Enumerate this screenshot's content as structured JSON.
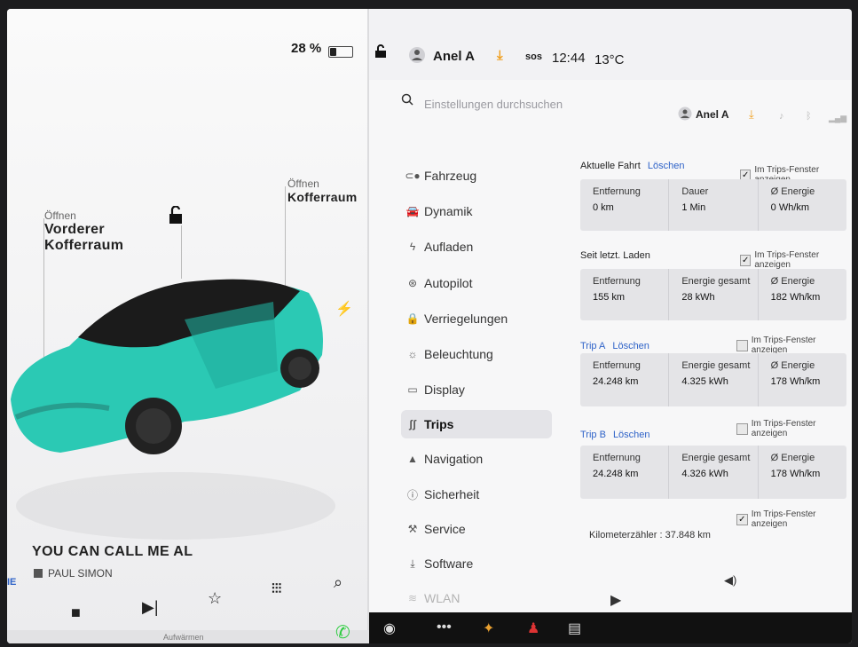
{
  "status": {
    "battery": "28 %",
    "battery_level": 0.28,
    "user": "Anel A",
    "sos": "sos",
    "time": "12:44",
    "temp": "13°C"
  },
  "car": {
    "frunk_open": "Öffnen",
    "frunk_title_1": "Vorderer",
    "frunk_title_2": "Kofferraum",
    "trunk_open": "Öffnen",
    "trunk_title": "Kofferraum",
    "body_color": "#2bc9b4"
  },
  "media": {
    "song": "YOU CAN CALL ME AL",
    "artist": "PAUL SIMON",
    "footer": "Aufwärmen"
  },
  "search": {
    "placeholder": "Einstellungen durchsuchen"
  },
  "header_right": {
    "user": "Anel A"
  },
  "nav": [
    {
      "label": "Fahrzeug",
      "icon": "toggle-icon"
    },
    {
      "label": "Dynamik",
      "icon": "car-icon"
    },
    {
      "label": "Aufladen",
      "icon": "bolt-icon"
    },
    {
      "label": "Autopilot",
      "icon": "steering-wheel-icon"
    },
    {
      "label": "Verriegelungen",
      "icon": "lock-icon"
    },
    {
      "label": "Beleuchtung",
      "icon": "sun-icon"
    },
    {
      "label": "Display",
      "icon": "display-icon"
    },
    {
      "label": "Trips",
      "icon": "trips-icon"
    },
    {
      "label": "Navigation",
      "icon": "navigation-icon"
    },
    {
      "label": "Sicherheit",
      "icon": "safety-icon"
    },
    {
      "label": "Service",
      "icon": "wrench-icon"
    },
    {
      "label": "Software",
      "icon": "download-icon"
    },
    {
      "label": "WLAN",
      "icon": "wifi-icon"
    }
  ],
  "trips": {
    "current": {
      "title": "Aktuelle Fahrt",
      "link": "Löschen",
      "show": "Im Trips-Fenster anzeigen",
      "checked": true,
      "labels": [
        "Entfernung",
        "Dauer",
        "Ø Energie"
      ],
      "values": [
        "0 km",
        "1 Min",
        "0 Wh/km"
      ]
    },
    "since_charge": {
      "title": "Seit letzt. Laden",
      "show": "Im Trips-Fenster anzeigen",
      "checked": true,
      "labels": [
        "Entfernung",
        "Energie gesamt",
        "Ø Energie"
      ],
      "values": [
        "155 km",
        "28 kWh",
        "182 Wh/km"
      ]
    },
    "trip_a": {
      "title": "Trip A",
      "link": "Löschen",
      "show": "Im Trips-Fenster anzeigen",
      "checked": false,
      "labels": [
        "Entfernung",
        "Energie gesamt",
        "Ø Energie"
      ],
      "values": [
        "24.248 km",
        "4.325 kWh",
        "178 Wh/km"
      ]
    },
    "trip_b": {
      "title": "Trip B",
      "link": "Löschen",
      "show": "Im Trips-Fenster anzeigen",
      "checked": false,
      "labels": [
        "Entfernung",
        "Energie gesamt",
        "Ø Energie"
      ],
      "values": [
        "24.248 km",
        "4.326 kWh",
        "178 Wh/km"
      ]
    },
    "odometer": "Kilometerzähler : 37.848 km",
    "odometer_show": "Im Trips-Fenster anzeigen",
    "odometer_checked": true
  },
  "colors": {
    "accent_blue": "#2f63c8",
    "download_orange": "#f0a020",
    "phone_green": "#2ecc40"
  }
}
